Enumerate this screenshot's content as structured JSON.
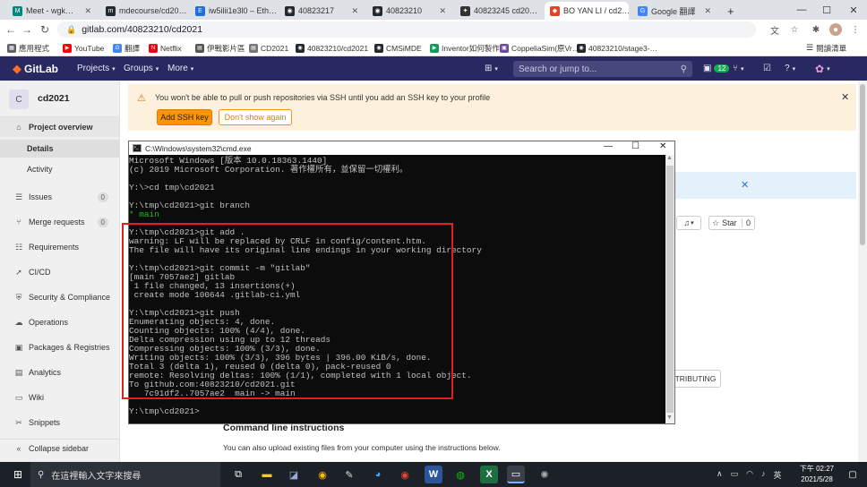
{
  "browser": {
    "tabs": [
      {
        "label": "Meet - wgk…",
        "color": "#00897b",
        "glyph": "M"
      },
      {
        "label": "mdecourse/cd20…",
        "color": "#24292e",
        "glyph": "m"
      },
      {
        "label": "iw5ilii1e3l0 – Eth…",
        "color": "#1e6fd9",
        "glyph": "E"
      },
      {
        "label": "40823217",
        "color": "#24292e",
        "glyph": "◉"
      },
      {
        "label": "40823210",
        "color": "#24292e",
        "glyph": "◉"
      },
      {
        "label": "40823245 cd20…",
        "color": "#333333",
        "glyph": "✦"
      },
      {
        "label": "BO YAN LI / cd2…",
        "color": "#e24329",
        "glyph": "◆"
      },
      {
        "label": "Google 翻譯",
        "color": "#4285f4",
        "glyph": "G"
      }
    ],
    "new_tab": "+",
    "url": "gitlab.com/40823210/cd2021",
    "bookmarks": [
      {
        "label": "應用程式",
        "color": "#5f6368",
        "glyph": "▦"
      },
      {
        "label": "YouTube",
        "color": "#ff0000",
        "glyph": "▶"
      },
      {
        "label": "翻譯",
        "color": "#4285f4",
        "glyph": "G"
      },
      {
        "label": "Netflix",
        "color": "#e50914",
        "glyph": "N"
      },
      {
        "label": "伊戰影片區",
        "color": "#555555",
        "glyph": "▤"
      },
      {
        "label": "CD2021",
        "color": "#777777",
        "glyph": "▤"
      },
      {
        "label": "40823210/cd2021",
        "color": "#24292e",
        "glyph": "◉"
      },
      {
        "label": "CMSiMDE",
        "color": "#24292e",
        "glyph": "◉"
      },
      {
        "label": "Inventor如何製作…",
        "color": "#0f9d58",
        "glyph": "▶"
      },
      {
        "label": "CoppeliaSim(原Vr…",
        "color": "#6d4c9f",
        "glyph": "▣"
      },
      {
        "label": "40823210/stage3-…",
        "color": "#24292e",
        "glyph": "◉"
      }
    ],
    "reading_list": "閱讀清單"
  },
  "gitlab": {
    "logo": "GitLab",
    "menus": [
      "Projects",
      "Groups",
      "More"
    ],
    "search_placeholder": "Search or jump to...",
    "mr_count": "12",
    "project_initial": "C",
    "project_name": "cd2021",
    "sidebar": [
      {
        "label": "Project overview",
        "icon": "home-icon"
      },
      {
        "label": "Details",
        "icon": ""
      },
      {
        "label": "Activity",
        "icon": ""
      },
      {
        "label": "Issues",
        "icon": "issues-icon",
        "count": "0"
      },
      {
        "label": "Merge requests",
        "icon": "merge-request-icon",
        "count": "0"
      },
      {
        "label": "Requirements",
        "icon": "requirements-icon"
      },
      {
        "label": "CI/CD",
        "icon": "rocket-icon"
      },
      {
        "label": "Security & Compliance",
        "icon": "shield-icon"
      },
      {
        "label": "Operations",
        "icon": "cloud-icon"
      },
      {
        "label": "Packages & Registries",
        "icon": "package-icon"
      },
      {
        "label": "Analytics",
        "icon": "chart-icon"
      },
      {
        "label": "Wiki",
        "icon": "book-icon"
      },
      {
        "label": "Snippets",
        "icon": "scissors-icon"
      },
      {
        "label": "Collapse sidebar",
        "icon": "collapse-icon"
      }
    ],
    "ssh_banner": {
      "message": "You won't be able to pull or push repositories via SSH until you add an SSH key to your profile",
      "add_button": "Add SSH key",
      "dismiss_button": "Don't show again"
    },
    "star_label": "Star",
    "star_count": "0",
    "contributing_label": "TRIBUTING",
    "cli_heading": "Command line instructions",
    "cli_text": "You can also upload existing files from your computer using the instructions below."
  },
  "cmd": {
    "title": "C:\\Windows\\system32\\cmd.exe",
    "lines": [
      {
        "text": "Microsoft Windows [版本 10.0.18363.1440]",
        "color": "#c0c0c0"
      },
      {
        "text": "(c) 2019 Microsoft Corporation. 著作權所有，並保留一切權利。",
        "color": "#c0c0c0"
      },
      {
        "text": "",
        "color": "#c0c0c0"
      },
      {
        "text": "Y:\\>cd tmp\\cd2021",
        "color": "#c0c0c0"
      },
      {
        "text": "",
        "color": "#c0c0c0"
      },
      {
        "text": "Y:\\tmp\\cd2021>git branch",
        "color": "#c0c0c0"
      },
      {
        "text": "* main",
        "color": "#23b823"
      },
      {
        "text": "",
        "color": "#c0c0c0"
      },
      {
        "text": "Y:\\tmp\\cd2021>git add .",
        "color": "#c0c0c0"
      },
      {
        "text": "warning: LF will be replaced by CRLF in config/content.htm.",
        "color": "#c0c0c0"
      },
      {
        "text": "The file will have its original line endings in your working directory",
        "color": "#c0c0c0"
      },
      {
        "text": "",
        "color": "#c0c0c0"
      },
      {
        "text": "Y:\\tmp\\cd2021>git commit -m \"gitlab\"",
        "color": "#c0c0c0"
      },
      {
        "text": "[main 7057ae2] gitlab",
        "color": "#c0c0c0"
      },
      {
        "text": " 1 file changed, 13 insertions(+)",
        "color": "#c0c0c0"
      },
      {
        "text": " create mode 100644 .gitlab-ci.yml",
        "color": "#c0c0c0"
      },
      {
        "text": "",
        "color": "#c0c0c0"
      },
      {
        "text": "Y:\\tmp\\cd2021>git push",
        "color": "#c0c0c0"
      },
      {
        "text": "Enumerating objects: 4, done.",
        "color": "#c0c0c0"
      },
      {
        "text": "Counting objects: 100% (4/4), done.",
        "color": "#c0c0c0"
      },
      {
        "text": "Delta compression using up to 12 threads",
        "color": "#c0c0c0"
      },
      {
        "text": "Compressing objects: 100% (3/3), done.",
        "color": "#c0c0c0"
      },
      {
        "text": "Writing objects: 100% (3/3), 396 bytes | 396.00 KiB/s, done.",
        "color": "#c0c0c0"
      },
      {
        "text": "Total 3 (delta 1), reused 0 (delta 0), pack-reused 0",
        "color": "#c0c0c0"
      },
      {
        "text": "remote: Resolving deltas: 100% (1/1), completed with 1 local object.",
        "color": "#c0c0c0"
      },
      {
        "text": "To github.com:40823210/cd2021.git",
        "color": "#c0c0c0"
      },
      {
        "text": "   7c91df2..7057ae2  main -> main",
        "color": "#c0c0c0"
      },
      {
        "text": "",
        "color": "#c0c0c0"
      },
      {
        "text": "Y:\\tmp\\cd2021>",
        "color": "#c0c0c0"
      }
    ]
  },
  "taskbar": {
    "search_placeholder": "在這裡輸入文字來搜尋",
    "time": "下午 02:27",
    "date": "2021/5/28",
    "ime": "英"
  }
}
